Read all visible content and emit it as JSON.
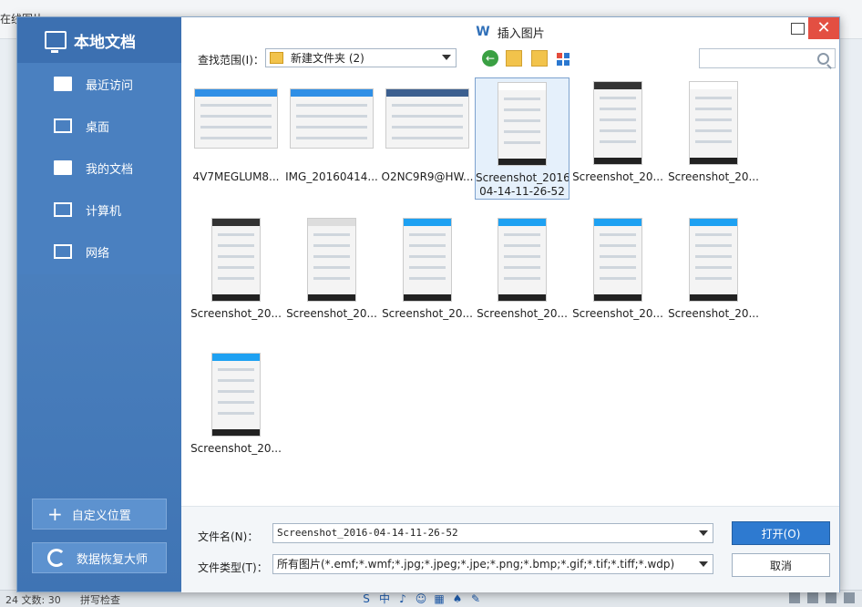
{
  "background": {
    "app_text_top": "在线图片",
    "status_left": "24 文数: 30",
    "status_mid": "拼写检查"
  },
  "dialog": {
    "title": "插入图片",
    "title_icon": "W",
    "sidebar": {
      "header": "本地文档",
      "items": [
        {
          "label": "最近访问",
          "icon": "recent-folder-icon"
        },
        {
          "label": "桌面",
          "icon": "desktop-monitor-icon"
        },
        {
          "label": "我的文档",
          "icon": "documents-folder-icon"
        },
        {
          "label": "计算机",
          "icon": "computer-icon"
        },
        {
          "label": "网络",
          "icon": "network-globe-icon"
        }
      ],
      "custom_location": "自定义位置",
      "data_recovery": "数据恢复大师"
    },
    "lookin_label": "查找范围(I)：",
    "current_folder": "新建文件夹 (2)",
    "files": [
      {
        "name": "4V7MEGLUM8...",
        "kind": "land"
      },
      {
        "name": "IMG_20160414...",
        "kind": "land"
      },
      {
        "name": "O2NC9R9@HW...",
        "kind": "land"
      },
      {
        "name": "Screenshot_2016-04-14-11-26-52",
        "kind": "port",
        "selected": true
      },
      {
        "name": "Screenshot_20...",
        "kind": "port"
      },
      {
        "name": "Screenshot_20...",
        "kind": "port"
      },
      {
        "name": "Screenshot_20...",
        "kind": "port"
      },
      {
        "name": "Screenshot_20...",
        "kind": "port"
      },
      {
        "name": "Screenshot_20...",
        "kind": "port"
      },
      {
        "name": "Screenshot_20...",
        "kind": "port"
      },
      {
        "name": "Screenshot_20...",
        "kind": "port"
      },
      {
        "name": "Screenshot_20...",
        "kind": "port"
      },
      {
        "name": "Screenshot_20...",
        "kind": "port"
      }
    ],
    "filename_label": "文件名(N)：",
    "filename_value": "Screenshot_2016-04-14-11-26-52",
    "filetype_label": "文件类型(T)：",
    "filetype_value": "所有图片(*.emf;*.wmf;*.jpg;*.jpeg;*.jpe;*.png;*.bmp;*.gif;*.tif;*.tiff;*.wdp)",
    "open_label": "打开(O)",
    "cancel_label": "取消"
  },
  "colors": {
    "sidebar": "#4a7fbd",
    "accent": "#2e7ad0",
    "close": "#e34f42",
    "selection": "#e5f0fb"
  }
}
